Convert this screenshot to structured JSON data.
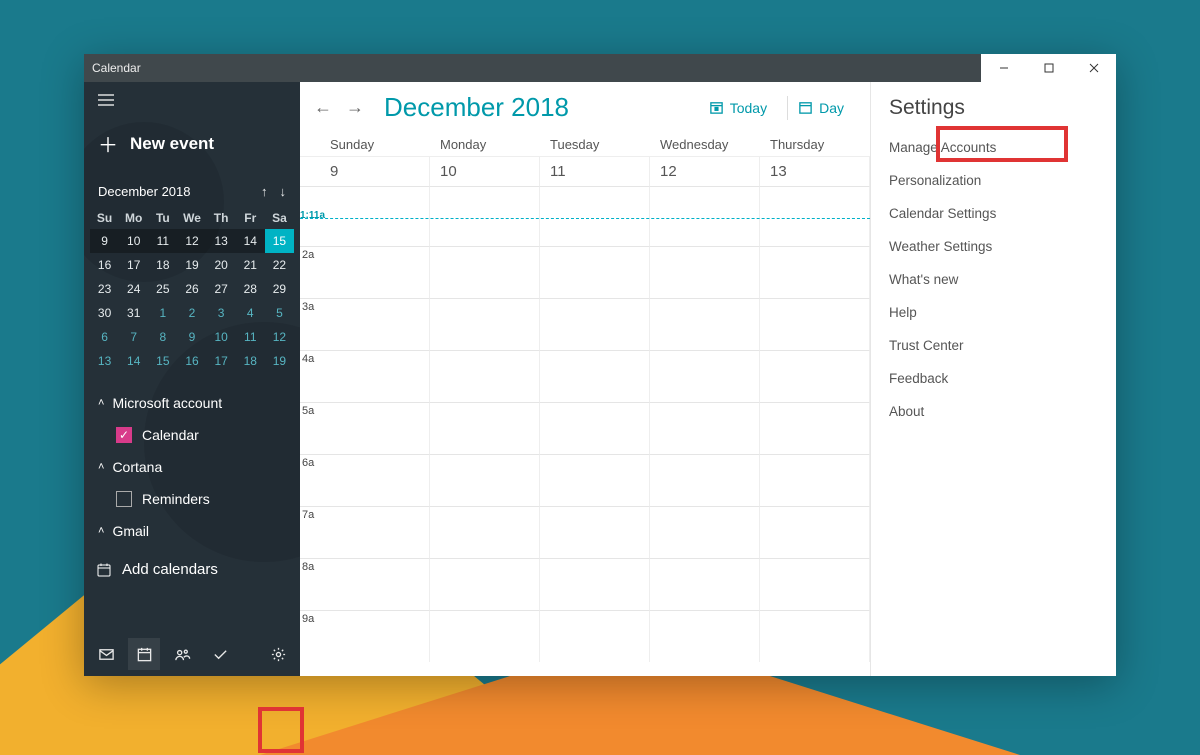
{
  "titlebar": {
    "title": "Calendar"
  },
  "sidebar": {
    "new_event": "New event",
    "mini_month": "December 2018",
    "dow": [
      "Su",
      "Mo",
      "Tu",
      "We",
      "Th",
      "Fr",
      "Sa"
    ],
    "weeks": [
      [
        {
          "n": "9"
        },
        {
          "n": "10"
        },
        {
          "n": "11"
        },
        {
          "n": "12"
        },
        {
          "n": "13"
        },
        {
          "n": "14"
        },
        {
          "n": "15",
          "sel": true
        }
      ],
      [
        {
          "n": "16"
        },
        {
          "n": "17"
        },
        {
          "n": "18"
        },
        {
          "n": "19"
        },
        {
          "n": "20"
        },
        {
          "n": "21"
        },
        {
          "n": "22"
        }
      ],
      [
        {
          "n": "23"
        },
        {
          "n": "24"
        },
        {
          "n": "25"
        },
        {
          "n": "26"
        },
        {
          "n": "27"
        },
        {
          "n": "28"
        },
        {
          "n": "29"
        }
      ],
      [
        {
          "n": "30"
        },
        {
          "n": "31"
        },
        {
          "n": "1",
          "off": true
        },
        {
          "n": "2",
          "off": true
        },
        {
          "n": "3",
          "off": true
        },
        {
          "n": "4",
          "off": true
        },
        {
          "n": "5",
          "off": true
        }
      ],
      [
        {
          "n": "6",
          "off": true
        },
        {
          "n": "7",
          "off": true
        },
        {
          "n": "8",
          "off": true
        },
        {
          "n": "9",
          "off": true
        },
        {
          "n": "10",
          "off": true
        },
        {
          "n": "11",
          "off": true
        },
        {
          "n": "12",
          "off": true
        }
      ],
      [
        {
          "n": "13",
          "off": true
        },
        {
          "n": "14",
          "off": true
        },
        {
          "n": "15",
          "off": true
        },
        {
          "n": "16",
          "off": true
        },
        {
          "n": "17",
          "off": true
        },
        {
          "n": "18",
          "off": true
        },
        {
          "n": "19",
          "off": true
        }
      ]
    ],
    "accounts": {
      "microsoft": {
        "label": "Microsoft account",
        "cal_label": "Calendar"
      },
      "cortana": {
        "label": "Cortana",
        "rem_label": "Reminders"
      },
      "gmail": {
        "label": "Gmail"
      }
    },
    "add_calendars": "Add calendars"
  },
  "main": {
    "title": "December 2018",
    "today": "Today",
    "day": "Day",
    "day_names": [
      "Sunday",
      "Monday",
      "Tuesday",
      "Wednesday",
      "Thursday"
    ],
    "dates": [
      "9",
      "10",
      "11",
      "12",
      "13"
    ],
    "now_label": "1:11a",
    "hours": [
      "2a",
      "3a",
      "4a",
      "5a",
      "6a",
      "7a",
      "8a",
      "9a"
    ]
  },
  "settings": {
    "title": "Settings",
    "items": [
      "Manage Accounts",
      "Personalization",
      "Calendar Settings",
      "Weather Settings",
      "What's new",
      "Help",
      "Trust Center",
      "Feedback",
      "About"
    ]
  }
}
